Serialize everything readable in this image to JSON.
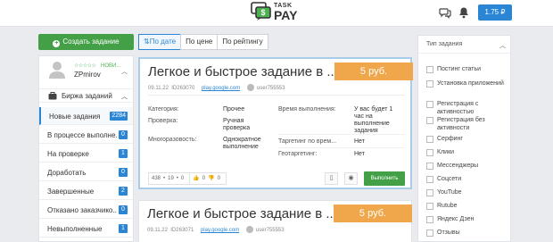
{
  "header": {
    "logo_top": "TASK",
    "logo_bottom": "PAY",
    "balance": "1.75 ₽",
    "icons": [
      "chat-icon",
      "bell-icon"
    ]
  },
  "sidebar": {
    "create_button": "Создать задание",
    "profile": {
      "stars": "☆☆☆☆☆",
      "status": "НОВИ...",
      "username": "ZPmirov"
    },
    "exchange_label": "Биржа заданий",
    "items": [
      {
        "label": "Новые задания",
        "count": "2284"
      },
      {
        "label": "В процессе выполне...",
        "count": "0"
      },
      {
        "label": "На проверке",
        "count": "1"
      },
      {
        "label": "Доработать",
        "count": "0"
      },
      {
        "label": "Завершенные",
        "count": "2"
      },
      {
        "label": "Отказано заказчико...",
        "count": "0"
      },
      {
        "label": "Невыполненные",
        "count": "1"
      }
    ]
  },
  "sort": {
    "tabs": [
      "По дате",
      "По цене",
      "По рейтингу"
    ],
    "active": "По дате"
  },
  "cards": [
    {
      "title": "Легкое и быстрое задание в ...",
      "price": "5 руб.",
      "date": "09.11.22",
      "id": "ID263070",
      "site": "play.google.com",
      "user": "user755553",
      "fields": {
        "category_label": "Категория:",
        "category_value": "Прочее",
        "check_label": "Проверка:",
        "check_value": "Ручная проверка",
        "multi_label": "Многоразовость:",
        "multi_value": "Однократное выполнение",
        "time_label": "Время выполнения:",
        "time_value": "У вас будет 1 час на выполнение задания",
        "target_label": "Таргетинг по врем...",
        "target_value": "Нет",
        "geo_label": "Геотаргетинг:",
        "geo_value": "Нет"
      },
      "stats": {
        "views": "438",
        "likes_count": "19",
        "extra": "0",
        "up": "0",
        "down": "0"
      },
      "execute_label": "Выполнить"
    },
    {
      "title": "Легкое и быстрое задание в ...",
      "price": "5 руб.",
      "date": "09.11.22",
      "id": "ID263071",
      "site": "play.google.com",
      "user": "user755553"
    }
  ],
  "filter": {
    "title": "Тип задания",
    "items": [
      "Постинг статьи",
      "Установка приложений",
      "Регистрация с активностью",
      "Регистрация без активности",
      "Серфинг",
      "Клики",
      "Мессенджеры",
      "Соцсети",
      "YouTube",
      "Rutube",
      "Яндекс Дзен",
      "Отзывы"
    ]
  },
  "colors": {
    "primary": "#2a86d4",
    "success": "#43a047",
    "price": "#f0a64a"
  }
}
